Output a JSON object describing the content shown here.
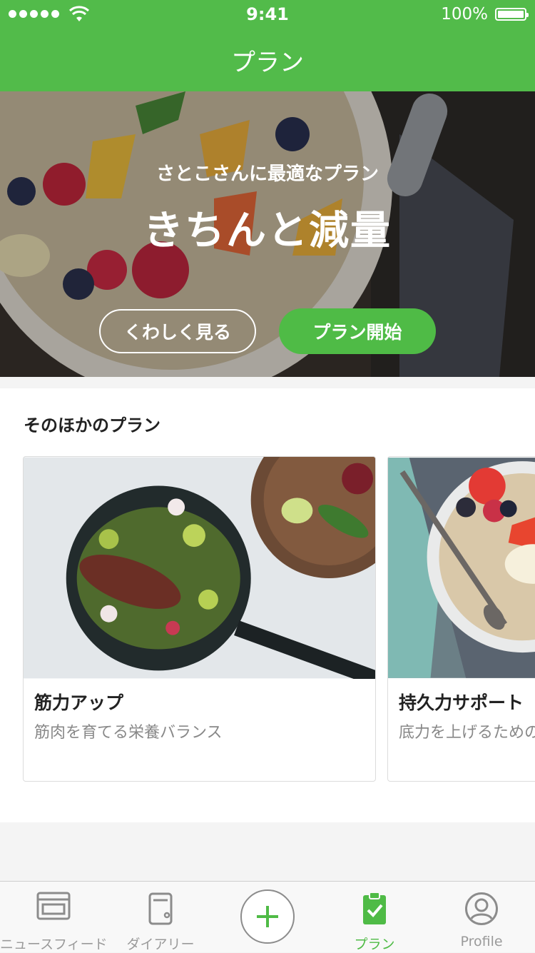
{
  "status_bar": {
    "time": "9:41",
    "battery": "100%"
  },
  "nav": {
    "title": "プラン"
  },
  "hero": {
    "subtitle": "さとこさんに最適なプラン",
    "title": "きちんと減量",
    "detail_button": "くわしく見る",
    "start_button": "プラン開始"
  },
  "other_plans": {
    "heading": "そのほかのプラン",
    "cards": [
      {
        "title": "筋力アップ",
        "description": "筋肉を育てる栄養バランス"
      },
      {
        "title": "持久力サポート",
        "description": "底力を上げるための"
      }
    ]
  },
  "tabbar": {
    "tabs": [
      {
        "label": "ニュースフィード",
        "icon": "newsfeed-icon"
      },
      {
        "label": "ダイアリー",
        "icon": "diary-icon"
      },
      {
        "label": "",
        "icon": "plus-icon"
      },
      {
        "label": "プラン",
        "icon": "plan-clipboard-icon"
      },
      {
        "label": "Profile",
        "icon": "profile-icon"
      }
    ],
    "active": "プラン"
  },
  "colors": {
    "brand_green": "#52bb4a",
    "tab_inactive": "#9a9a9a"
  }
}
